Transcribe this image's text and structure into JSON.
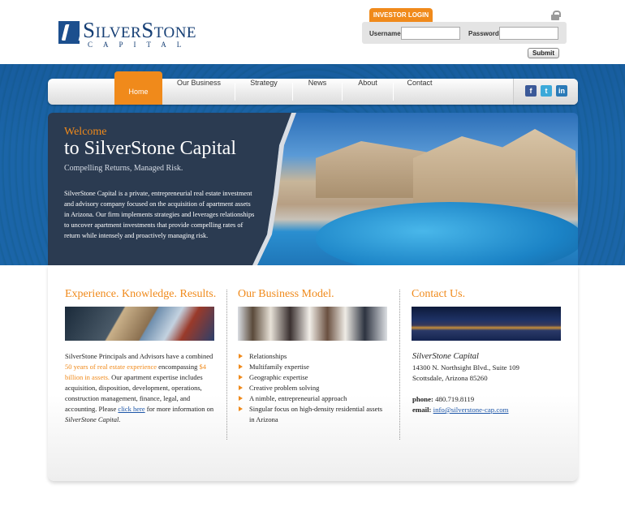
{
  "brand": {
    "name": "SilverStone",
    "sub": "CAPITAL"
  },
  "login": {
    "tab_label": "INVESTOR LOGIN",
    "username_label": "Username:",
    "password_label": "Password:",
    "username_value": "",
    "password_value": "",
    "submit_label": "Submit"
  },
  "nav": {
    "items": [
      "Home",
      "Our Business",
      "Strategy",
      "News",
      "About",
      "Contact"
    ],
    "active": "Home",
    "social": [
      "facebook",
      "twitter",
      "linkedin"
    ]
  },
  "hero": {
    "welcome": "Welcome",
    "title": "to SilverStone Capital",
    "subtitle": "Compelling Returns, Managed Risk.",
    "body": "SilverStone Capital is a private, entrepreneurial real estate investment and advisory company focused on the acquisition of apartment assets in Arizona. Our firm implements strategies and leverages relationships to uncover apartment investments that provide compelling rates of return while intensely and proactively managing risk."
  },
  "col1": {
    "title": "Experience. Knowledge. Results.",
    "t1": "SilverStone Principals and Advisors have a combined ",
    "hl1": "50 years of real estate experience",
    "t2": " encompassing ",
    "hl2": "$4 billion in assets.",
    "t3": " Our apartment expertise includes acquisition, disposition, development, operations, construction management, finance, legal, and accounting. Please ",
    "link": "click here",
    "t4": " for more information on ",
    "em": "SilverStone Capital."
  },
  "col2": {
    "title": "Our Business Model.",
    "bullets": [
      "Relationships",
      "Multifamily expertise",
      "Geographic expertise",
      "Creative problem solving",
      "A nimble, entrepreneurial approach",
      "Singular focus on high-density residential assets in Arizona"
    ]
  },
  "col3": {
    "title": "Contact Us.",
    "company": "SilverStone Capital",
    "address1": "14300 N. Northsight Blvd., Suite 109",
    "address2": "Scottsdale, Arizona 85260",
    "phone_label": "phone:",
    "phone": "480.719.8119",
    "email_label": "email:",
    "email": "info@silverstone-cap.com"
  }
}
